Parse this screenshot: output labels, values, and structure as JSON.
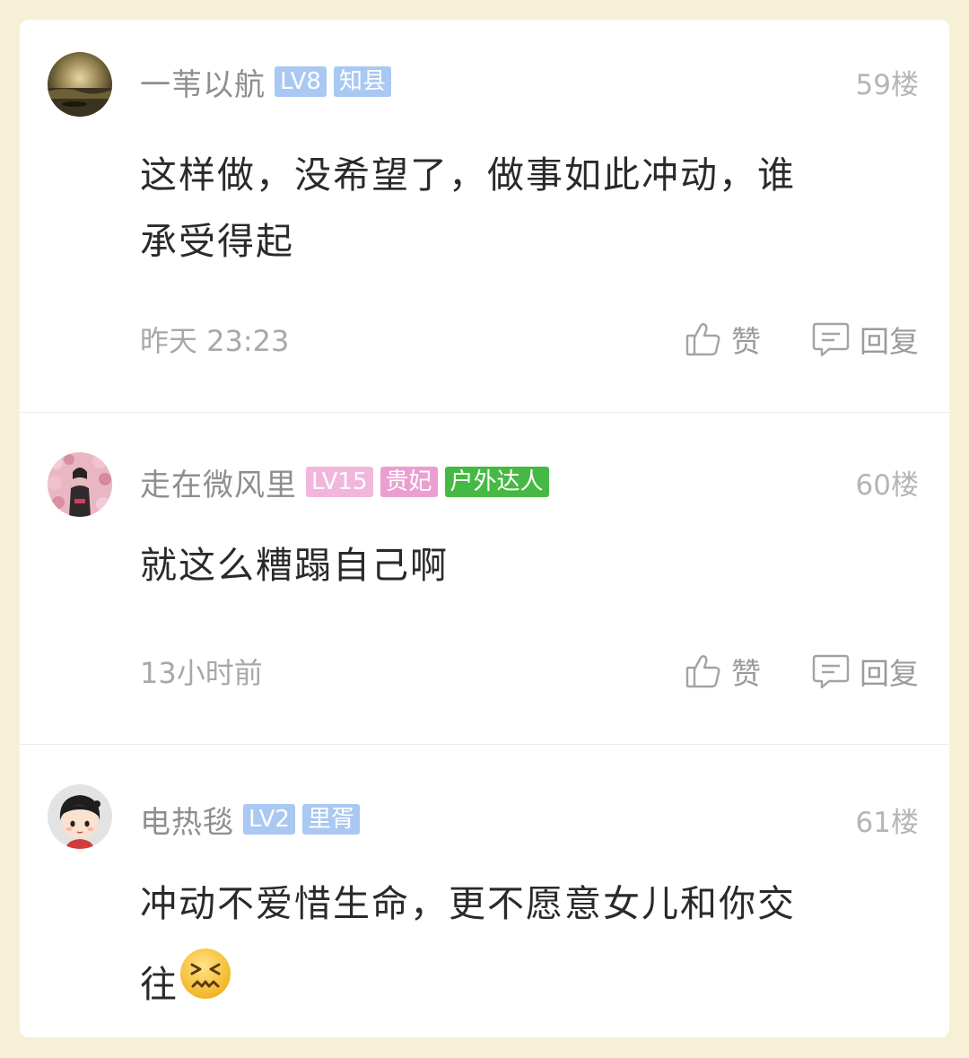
{
  "comments": [
    {
      "username": "一苇以航",
      "level": "LV8",
      "title": "知县",
      "floor": "59楼",
      "content_line1": "这样做，没希望了，做事如此冲动，谁",
      "content_line2": "承受得起",
      "time": "昨天 23:23",
      "like_label": "赞",
      "reply_label": "回复",
      "avatar_icon": "sunset-landscape-avatar"
    },
    {
      "username": "走在微风里",
      "level": "LV15",
      "title": "贵妃",
      "tag": "户外达人",
      "floor": "60楼",
      "content_line1": "就这么糟蹋自己啊",
      "time": "13小时前",
      "like_label": "赞",
      "reply_label": "回复",
      "avatar_icon": "flower-wall-person-avatar"
    },
    {
      "username": "电热毯",
      "level": "LV2",
      "title": "里胥",
      "floor": "61楼",
      "content_line1": "冲动不爱惜生命，更不愿意女儿和你交",
      "content_line2": "往",
      "emoji": "confounded-face-emoji",
      "avatar_icon": "cartoon-girl-avatar"
    }
  ],
  "colors": {
    "page_bg": "#f6f1d6",
    "badge_blue": "#a9c8f2",
    "badge_pink": "#f2b6dc",
    "badge_green": "#46b944"
  }
}
